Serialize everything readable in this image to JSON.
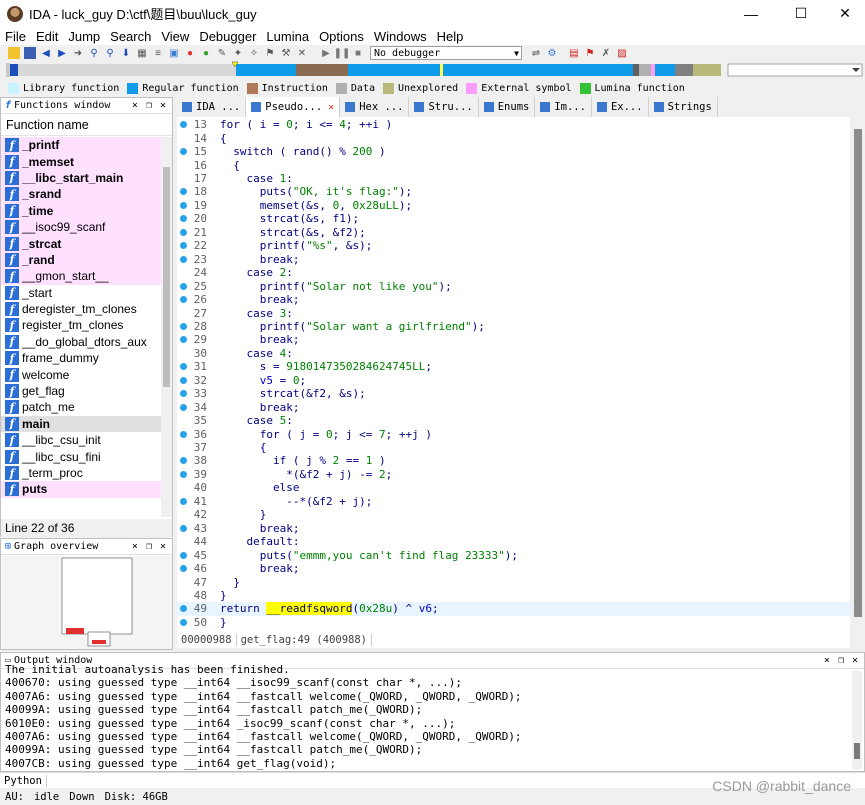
{
  "window": {
    "title": "IDA - luck_guy D:\\ctf\\题目\\buu\\luck_guy",
    "minimize": "—",
    "maximize": "☐",
    "close": "✕"
  },
  "menu": [
    "File",
    "Edit",
    "Jump",
    "Search",
    "View",
    "Debugger",
    "Lumina",
    "Options",
    "Windows",
    "Help"
  ],
  "toolbar": {
    "debugger_select": "No debugger"
  },
  "legend": [
    {
      "label": "Library function",
      "color": "#c8f4ff"
    },
    {
      "label": "Regular function",
      "color": "#0e9be8"
    },
    {
      "label": "Instruction",
      "color": "#b07a5a"
    },
    {
      "label": "Data",
      "color": "#b0b0b0"
    },
    {
      "label": "Unexplored",
      "color": "#b8b87a"
    },
    {
      "label": "External symbol",
      "color": "#ff9cff"
    },
    {
      "label": "Lumina function",
      "color": "#36c236"
    }
  ],
  "functions_window": {
    "title": "Functions window",
    "column": "Function name",
    "items": [
      {
        "name": "_printf",
        "bold": true,
        "pink": true
      },
      {
        "name": "_memset",
        "bold": true,
        "pink": true
      },
      {
        "name": "__libc_start_main",
        "bold": true,
        "pink": true
      },
      {
        "name": "_srand",
        "bold": true,
        "pink": true
      },
      {
        "name": "_time",
        "bold": true,
        "pink": true
      },
      {
        "name": "__isoc99_scanf",
        "bold": false,
        "pink": true
      },
      {
        "name": "_strcat",
        "bold": true,
        "pink": true
      },
      {
        "name": "_rand",
        "bold": true,
        "pink": true
      },
      {
        "name": "__gmon_start__",
        "bold": false,
        "pink": true
      },
      {
        "name": "_start",
        "bold": false,
        "pink": false
      },
      {
        "name": "deregister_tm_clones",
        "bold": false,
        "pink": false
      },
      {
        "name": "register_tm_clones",
        "bold": false,
        "pink": false
      },
      {
        "name": "__do_global_dtors_aux",
        "bold": false,
        "pink": false
      },
      {
        "name": "frame_dummy",
        "bold": false,
        "pink": false
      },
      {
        "name": "welcome",
        "bold": false,
        "pink": false
      },
      {
        "name": "get_flag",
        "bold": false,
        "pink": false
      },
      {
        "name": "patch_me",
        "bold": false,
        "pink": false
      },
      {
        "name": "main",
        "bold": true,
        "pink": false,
        "selected": true
      },
      {
        "name": "__libc_csu_init",
        "bold": false,
        "pink": false
      },
      {
        "name": "__libc_csu_fini",
        "bold": false,
        "pink": false
      },
      {
        "name": "_term_proc",
        "bold": false,
        "pink": false
      },
      {
        "name": "puts",
        "bold": true,
        "pink": true
      }
    ],
    "line_count": "Line 22 of 36"
  },
  "graph_overview": {
    "title": "Graph overview"
  },
  "tabs": [
    {
      "label": "IDA ...",
      "active": false,
      "closable": false,
      "color": "#3a78d0"
    },
    {
      "label": "Pseudo...",
      "active": true,
      "closable": true,
      "color": "#3a78d0"
    },
    {
      "label": "Hex ...",
      "active": false,
      "closable": false,
      "color": "#3a78d0"
    },
    {
      "label": "Stru...",
      "active": false,
      "closable": false,
      "color": "#3a78d0"
    },
    {
      "label": "Enums",
      "active": false,
      "closable": false,
      "color": "#3a78d0"
    },
    {
      "label": "Im...",
      "active": false,
      "closable": false,
      "color": "#3a78d0"
    },
    {
      "label": "Ex...",
      "active": false,
      "closable": false,
      "color": "#3a78d0"
    },
    {
      "label": "Strings",
      "active": false,
      "closable": false,
      "color": "#3a78d0"
    }
  ],
  "code": [
    {
      "n": "13",
      "dot": true,
      "t": "for ( i = 0; i <= 4; ++i )"
    },
    {
      "n": "14",
      "dot": false,
      "t": "{"
    },
    {
      "n": "15",
      "dot": true,
      "t": "  switch ( rand() % 200 )"
    },
    {
      "n": "16",
      "dot": false,
      "t": "  {"
    },
    {
      "n": "17",
      "dot": false,
      "t": "    case 1:"
    },
    {
      "n": "18",
      "dot": true,
      "t": "      puts(\"OK, it's flag:\");"
    },
    {
      "n": "19",
      "dot": true,
      "t": "      memset(&s, 0, 0x28uLL);"
    },
    {
      "n": "20",
      "dot": true,
      "t": "      strcat(&s, f1);"
    },
    {
      "n": "21",
      "dot": true,
      "t": "      strcat(&s, &f2);"
    },
    {
      "n": "22",
      "dot": true,
      "t": "      printf(\"%s\", &s);"
    },
    {
      "n": "23",
      "dot": true,
      "t": "      break;"
    },
    {
      "n": "24",
      "dot": false,
      "t": "    case 2:"
    },
    {
      "n": "25",
      "dot": true,
      "t": "      printf(\"Solar not like you\");"
    },
    {
      "n": "26",
      "dot": true,
      "t": "      break;"
    },
    {
      "n": "27",
      "dot": false,
      "t": "    case 3:"
    },
    {
      "n": "28",
      "dot": true,
      "t": "      printf(\"Solar want a girlfriend\");"
    },
    {
      "n": "29",
      "dot": true,
      "t": "      break;"
    },
    {
      "n": "30",
      "dot": false,
      "t": "    case 4:"
    },
    {
      "n": "31",
      "dot": true,
      "t": "      s = 9180147350284624745LL;"
    },
    {
      "n": "32",
      "dot": true,
      "t": "      v5 = 0;"
    },
    {
      "n": "33",
      "dot": true,
      "t": "      strcat(&f2, &s);"
    },
    {
      "n": "34",
      "dot": true,
      "t": "      break;"
    },
    {
      "n": "35",
      "dot": false,
      "t": "    case 5:"
    },
    {
      "n": "36",
      "dot": true,
      "t": "      for ( j = 0; j <= 7; ++j )"
    },
    {
      "n": "37",
      "dot": false,
      "t": "      {"
    },
    {
      "n": "38",
      "dot": true,
      "t": "        if ( j % 2 == 1 )"
    },
    {
      "n": "39",
      "dot": true,
      "t": "          *(&f2 + j) -= 2;"
    },
    {
      "n": "40",
      "dot": false,
      "t": "        else"
    },
    {
      "n": "41",
      "dot": true,
      "t": "          --*(&f2 + j);"
    },
    {
      "n": "42",
      "dot": false,
      "t": "      }"
    },
    {
      "n": "43",
      "dot": true,
      "t": "      break;"
    },
    {
      "n": "44",
      "dot": false,
      "t": "    default:"
    },
    {
      "n": "45",
      "dot": true,
      "t": "      puts(\"emmm,you can't find flag 23333\");"
    },
    {
      "n": "46",
      "dot": true,
      "t": "      break;"
    },
    {
      "n": "47",
      "dot": false,
      "t": "  }"
    },
    {
      "n": "48",
      "dot": false,
      "t": "}"
    },
    {
      "n": "49",
      "dot": true,
      "t": "return __readfsqword(0x28u) ^ v6;",
      "highlight": true
    },
    {
      "n": "50",
      "dot": true,
      "t": "}"
    }
  ],
  "code_footer": {
    "address": "00000988",
    "location": "get_flag:49 (400988)"
  },
  "output": {
    "title": "Output window",
    "lines": [
      "The initial autoanalysis has been finished.",
      "400670: using guessed type __int64 __isoc99_scanf(const char *, ...);",
      "4007A6: using guessed type __int64 __fastcall welcome(_QWORD, _QWORD, _QWORD);",
      "40099A: using guessed type __int64 __fastcall patch_me(_QWORD);",
      "6010E0: using guessed type __int64 _isoc99_scanf(const char *, ...);",
      "4007A6: using guessed type __int64 __fastcall welcome(_QWORD, _QWORD, _QWORD);",
      "40099A: using guessed type __int64 __fastcall patch_me(_QWORD);",
      "4007CB: using guessed type __int64 get_flag(void);"
    ],
    "lang": "Python"
  },
  "status": {
    "au": "AU:",
    "state": "idle",
    "dir": "Down",
    "disk": "Disk: 46GB"
  },
  "watermark": "CSDN @rabbit_dance"
}
